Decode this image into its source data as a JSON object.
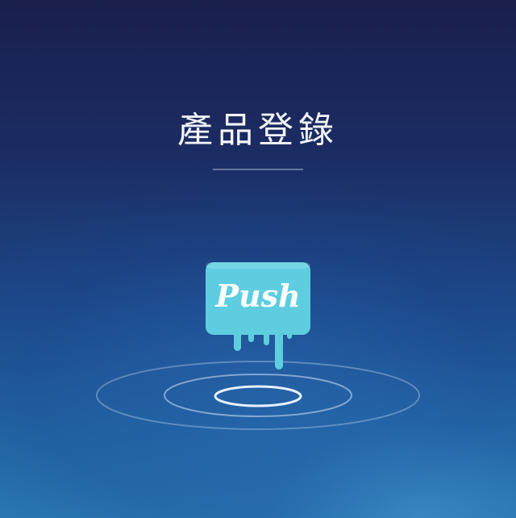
{
  "page": {
    "title": "產品登錄"
  },
  "logo": {
    "text": "Push",
    "icon": "push-drip-logo",
    "color": "#5fcde0"
  },
  "colors": {
    "background_top": "#1a1f4d",
    "background_bottom": "#2a78b2",
    "ring_stroke": "#cfe2f5"
  }
}
